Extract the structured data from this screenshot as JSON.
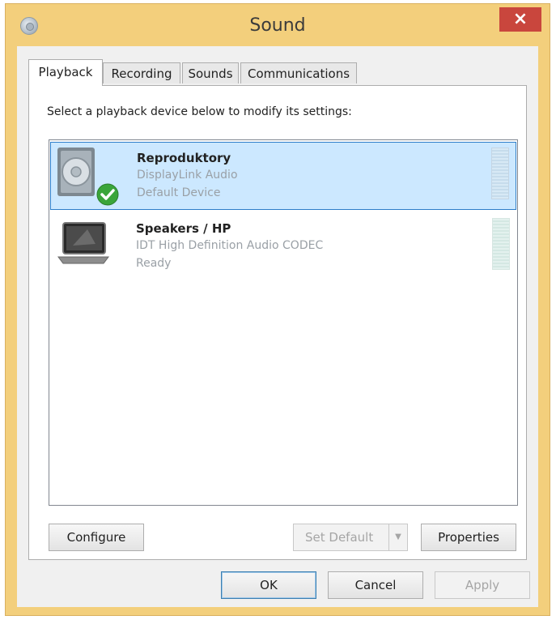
{
  "window": {
    "title": "Sound",
    "close_label": "×"
  },
  "tabs": [
    {
      "label": "Playback"
    },
    {
      "label": "Recording"
    },
    {
      "label": "Sounds"
    },
    {
      "label": "Communications"
    }
  ],
  "playback": {
    "instruction": "Select a playback device below to modify its settings:",
    "devices": [
      {
        "name": "Reproduktory",
        "driver": "DisplayLink Audio",
        "status": "Default Device"
      },
      {
        "name": "Speakers / HP",
        "driver": "IDT High Definition Audio CODEC",
        "status": "Ready"
      }
    ],
    "buttons": {
      "configure": "Configure",
      "set_default": "Set Default",
      "properties": "Properties"
    }
  },
  "footer": {
    "ok": "OK",
    "cancel": "Cancel",
    "apply": "Apply"
  },
  "colors": {
    "accent_titlebar": "#f3cf7c",
    "close": "#c9463d",
    "selection": "#cce8ff"
  }
}
